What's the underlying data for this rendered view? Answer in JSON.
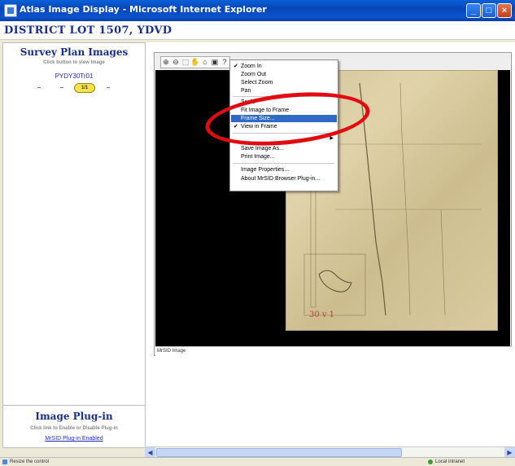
{
  "window": {
    "title": "Atlas Image Display - Microsoft Internet Explorer"
  },
  "header": {
    "title": "DISTRICT LOT 1507, YDVD"
  },
  "left_panel": {
    "title": "Survey Plan Images",
    "hint": "Click button to view Image",
    "plan_name": "PYDY30Tr01",
    "page_badge": "1/1",
    "plugin_title": "Image Plug-in",
    "plugin_hint": "Click link to Enable or Disable Plug-in",
    "plugin_link": "MrSID Plug-in Enabled"
  },
  "viewer": {
    "caption": "MrSID Image",
    "toolbar_icons": [
      "zoom-in-icon",
      "zoom-out-icon",
      "select-zoom-icon",
      "pan-icon",
      "home-icon",
      "frame-icon",
      "help-icon"
    ]
  },
  "context_menu": {
    "items": [
      {
        "label": "Zoom In",
        "checked": true
      },
      {
        "label": "Zoom Out"
      },
      {
        "label": "Select Zoom"
      },
      {
        "label": "Pan"
      },
      {
        "label": "Scale"
      },
      {
        "label": "Fit Image to Frame"
      },
      {
        "label": "Frame Size...",
        "selected": true
      },
      {
        "label": "View in Frame",
        "checked": true
      },
      {
        "label": "Save Image As..."
      },
      {
        "label": "Print Image..."
      },
      {
        "label": "Image Properties..."
      },
      {
        "label": "About MrSID Browser Plug-in..."
      }
    ],
    "selection_color": "#316ac5"
  },
  "map_image": {
    "label": "30 v 1"
  },
  "status_bar": {
    "text": "Resize the control",
    "zone": "Local intranet"
  },
  "colors": {
    "annotation_ring": "#e30b12",
    "title_text": "#1a2f8a",
    "titlebar": "#0a5fd8"
  }
}
